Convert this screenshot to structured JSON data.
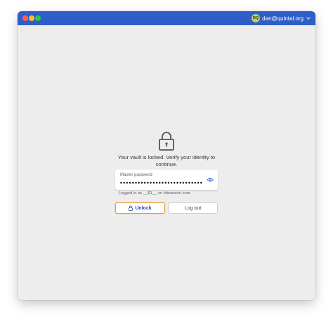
{
  "titlebar": {
    "account": {
      "initials": "DQ",
      "email": "dan@quintal.org",
      "avatar_color": "#b9cf6a",
      "dropdown_icon": "chevron-down-icon"
    },
    "bar_color": "#2f5ec9"
  },
  "lock_screen": {
    "icon": "lock-icon",
    "message": "Your vault is locked. Verify your identity to continue.",
    "password": {
      "label": "Master password",
      "value": "••••••••••••••••••••••••••••••",
      "toggle_icon": "eye-icon"
    },
    "logged_in_text": "Logged in as __$1__ on bitwarden.com.",
    "buttons": {
      "unlock": "Unlock",
      "logout": "Log out"
    },
    "accent_color": "#1a52b3",
    "focus_color": "#e89b2b"
  }
}
